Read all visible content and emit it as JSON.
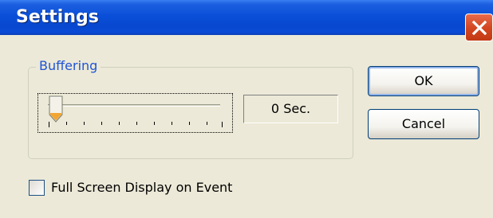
{
  "window": {
    "title": "Settings"
  },
  "buffering": {
    "group_label": "Buffering",
    "slider_level": 0,
    "value_text": "0 Sec."
  },
  "buttons": {
    "ok_label": "OK",
    "cancel_label": "Cancel"
  },
  "options": {
    "full_screen_label": "Full Screen Display on Event",
    "full_screen_checked": false
  },
  "colors": {
    "titlebar": "#0a4fd8",
    "face": "#ece9d8",
    "close": "#d2451f",
    "group_label": "#1f54d6"
  },
  "icons": {
    "close": "close-icon",
    "thumb": "slider-thumb"
  }
}
